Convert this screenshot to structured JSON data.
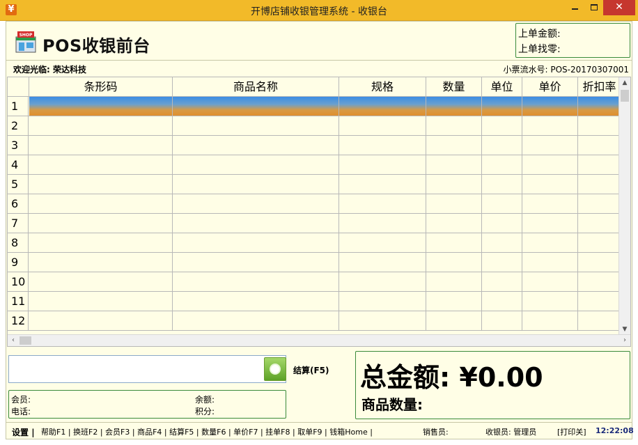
{
  "window": {
    "title": "开博店铺收银管理系统 - 收银台",
    "app_icon": "¥"
  },
  "header": {
    "app_title": "POS收银前台",
    "last_amount_label": "上单金额:",
    "last_change_label": "上单找零:"
  },
  "info": {
    "welcome": "欢迎光临: 荣达科技",
    "receipt": "小票流水号: POS-20170307001"
  },
  "grid": {
    "columns": [
      "条形码",
      "商品名称",
      "规格",
      "数量",
      "单位",
      "单价",
      "折扣率"
    ],
    "rows": [
      "1",
      "2",
      "3",
      "4",
      "5",
      "6",
      "7",
      "8",
      "9",
      "10",
      "11",
      "12"
    ]
  },
  "checkout": {
    "label": "结算(F5)"
  },
  "member": {
    "member_label": "会员:",
    "phone_label": "电话:",
    "balance_label": "余额:",
    "points_label": "积分:"
  },
  "totals": {
    "total_label": "总金额: ¥0.00",
    "quantity_label": "商品数量:"
  },
  "status": {
    "settings": "设置",
    "shortcuts": "帮助F1 | 换班F2 | 会员F3 | 商品F4 | 结算F5 | 数量F6 | 单价F7 | 挂单F8 | 取单F9 | 钱箱Home |",
    "salesperson": "销售员:",
    "cashier": "收银员: 管理员",
    "print": "[打印关]",
    "time": "12:22:08"
  }
}
